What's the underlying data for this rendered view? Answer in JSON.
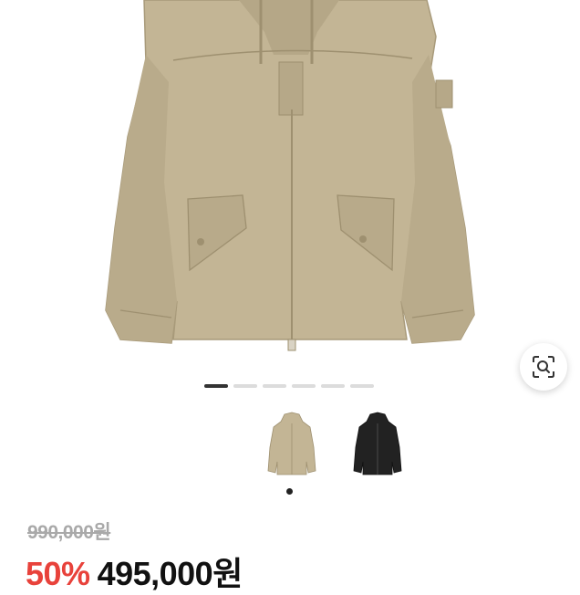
{
  "product": {
    "image_alt": "beige hooded jacket",
    "images_count": 6,
    "active_image_index": 0,
    "colors": [
      "beige",
      "black"
    ],
    "selected_color_index": 0
  },
  "price": {
    "original": "990,000원",
    "discount": "50%",
    "sale": "495,000원"
  },
  "icons": {
    "lens": "lens-search-icon"
  },
  "colors": {
    "discount": "#e8423b",
    "jacket_beige": "#c3b595",
    "jacket_black": "#222222"
  }
}
